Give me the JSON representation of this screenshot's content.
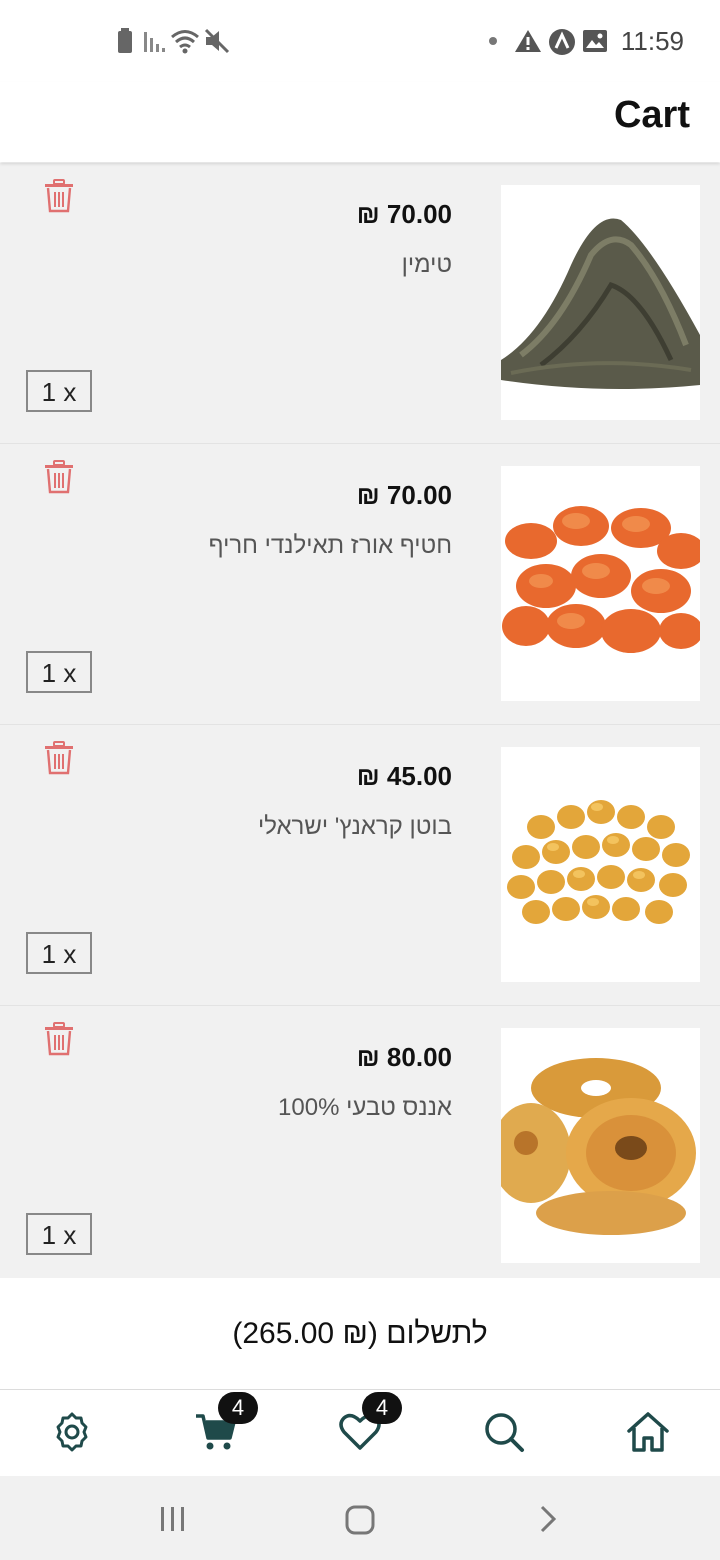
{
  "status_bar": {
    "time": "11:59",
    "icons": [
      "battery-icon",
      "signal-icon",
      "wifi-icon",
      "mute-icon",
      "dot-icon",
      "alert-icon",
      "app-icon",
      "image-icon"
    ]
  },
  "app_bar": {
    "title": "Cart"
  },
  "cart": {
    "items": [
      {
        "price": "70.00 ₪",
        "name": "טימין",
        "quantity": "1 x",
        "image": "thyme-photo"
      },
      {
        "price": "70.00 ₪",
        "name": "חטיף אורז תאילנדי חריף",
        "quantity": "1 x",
        "image": "rice-snack-photo"
      },
      {
        "price": "45.00 ₪",
        "name": "בוטן קראנץ' ישראלי",
        "quantity": "1 x",
        "image": "peanut-photo"
      },
      {
        "price": "80.00 ₪",
        "name": "אננס טבעי 100%",
        "quantity": "1 x",
        "image": "pineapple-photo"
      }
    ]
  },
  "checkout": {
    "label": "לתשלום (₪ 265.00)"
  },
  "bottom_nav": {
    "items": [
      "settings-icon",
      "cart-icon",
      "heart-icon",
      "search-icon",
      "home-icon"
    ],
    "cart_badge": "4",
    "favorites_badge": "4",
    "accent": "#1f4a4a"
  },
  "colors": {
    "delete": "#e07070",
    "list_bg": "#f1f1f1"
  }
}
